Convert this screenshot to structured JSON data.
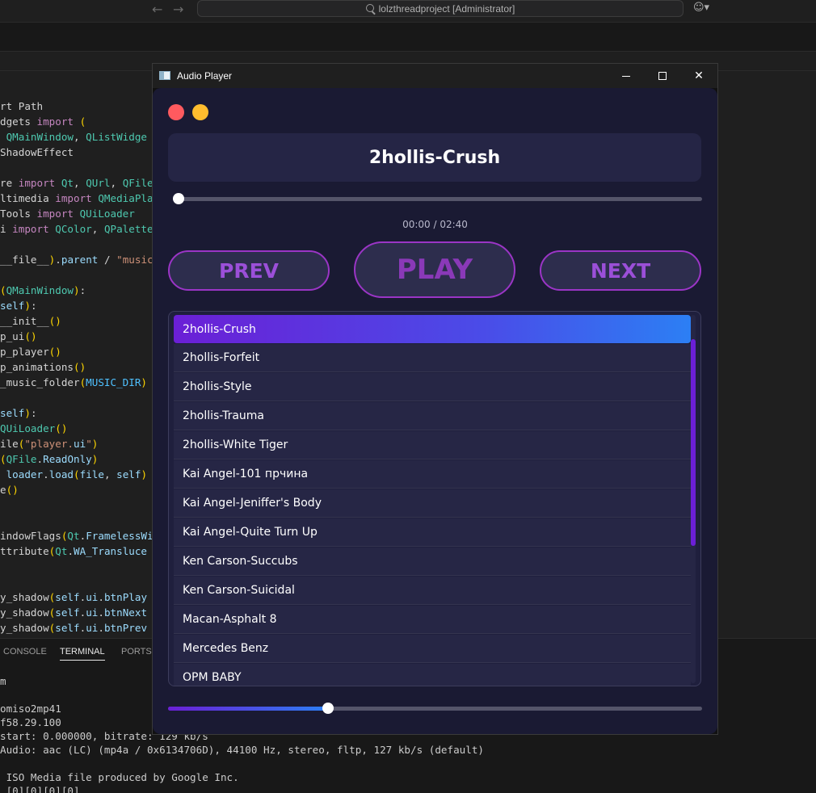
{
  "vscode": {
    "search_text": "lolzthreadproject [Administrator]",
    "code_lines": [
      "rt Path",
      "dgets import (",
      " QMainWindow, QListWidge",
      "ShadowEffect",
      "",
      "re import Qt, QUrl, QFile",
      "ltimedia import QMediaPla",
      "Tools import QUiLoader",
      "i import QColor, QPalette",
      "",
      "__file__).parent / \"music",
      "",
      "(QMainWindow):",
      "self):",
      "__init__()",
      "p_ui()",
      "p_player()",
      "p_animations()",
      "_music_folder(MUSIC_DIR)",
      "",
      "self):",
      "QUiLoader()",
      "ile(\"player.ui\")",
      "(QFile.ReadOnly)",
      " loader.load(file, self)",
      "e()",
      "",
      "",
      "indowFlags(Qt.FramelessWi",
      "ttribute(Qt.WA_Transluce",
      "",
      "",
      "y_shadow(self.ui.btnPlay",
      "y_shadow(self.ui.btnNext",
      "y_shadow(self.ui.btnPrev"
    ],
    "panel_tabs": [
      "CONSOLE",
      "TERMINAL",
      "PORTS"
    ],
    "active_panel_tab": "TERMINAL",
    "terminal_lines": [
      "m",
      "",
      "omiso2mp41",
      "f58.29.100",
      "start: 0.000000, bitrate: 129 kb/s",
      "Audio: aac (LC) (mp4a / 0x6134706D), 44100 Hz, stereo, fltp, 127 kb/s (default)",
      "",
      " ISO Media file produced by Google Inc.",
      " [0][0][0][0]"
    ]
  },
  "window": {
    "title": "Audio Player",
    "controls": {
      "minimize": "minimize",
      "maximize": "maximize",
      "close": "✕"
    }
  },
  "player": {
    "current_track": "2hollis-Crush",
    "time_display": "00:00 / 02:40",
    "progress_fraction": 0.0,
    "volume_fraction": 0.3,
    "buttons": {
      "prev": "PREV",
      "play": "PLAY",
      "next": "NEXT"
    },
    "selected_index": 0,
    "playlist": [
      "2hollis-Crush",
      "2hollis-Forfeit",
      "2hollis-Style",
      "2hollis-Trauma",
      "2hollis-White Tiger",
      "Kai Angel-101 прчина",
      "Kai Angel-Jeniffer's Body",
      "Kai Angel-Quite Turn Up",
      "Ken Carson-Succubs",
      "Ken Carson-Suicidal",
      "Macan-Asphalt 8",
      "Mercedes Benz",
      "OPM BABY"
    ],
    "colors": {
      "accent_purple": "#9b35c6",
      "selected_gradient_start": "#6b1fd6",
      "selected_gradient_end": "#2c7ff4",
      "close_dot": "#ff5a5f",
      "minimize_dot": "#ffbd2e"
    }
  }
}
